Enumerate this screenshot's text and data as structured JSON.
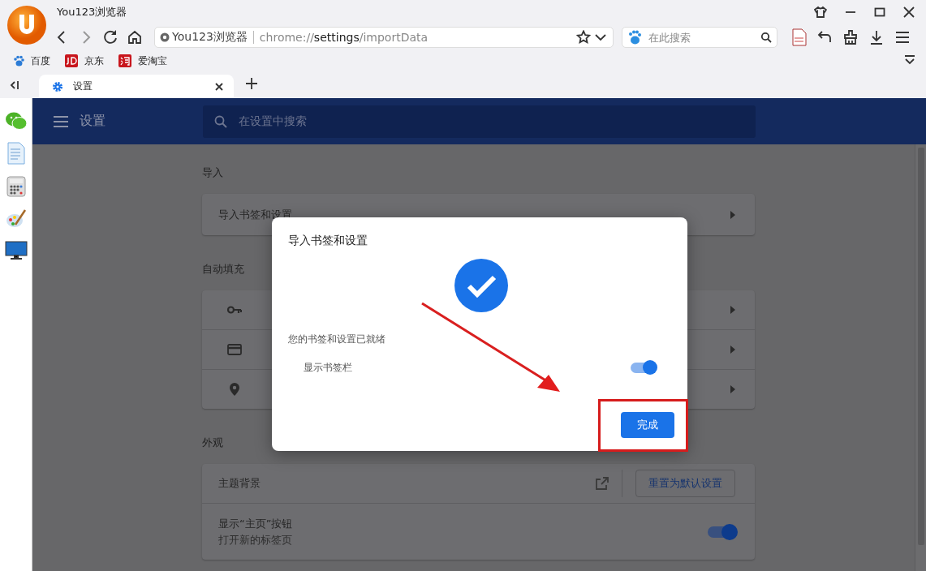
{
  "window": {
    "title": "You123浏览器"
  },
  "address_bar": {
    "site_label": "You123浏览器",
    "url": "chrome://**settings**/importData"
  },
  "search_box": {
    "placeholder": "在此搜索"
  },
  "bookmarks": [
    {
      "label": "百度"
    },
    {
      "label": "京东"
    },
    {
      "label": "爱淘宝"
    }
  ],
  "tabs": [
    {
      "label": "设置",
      "selected": true
    }
  ],
  "settings": {
    "title": "设置",
    "search_placeholder": "在设置中搜索",
    "sections": [
      {
        "heading": "导入",
        "rows": [
          {
            "kind": "link",
            "label": "导入书签和设置"
          }
        ]
      },
      {
        "heading": "自动填充",
        "rows": [
          {
            "kind": "key"
          },
          {
            "kind": "card"
          },
          {
            "kind": "pin"
          }
        ]
      },
      {
        "heading": "外观",
        "rows": [
          {
            "kind": "theme",
            "label": "主题背景",
            "button": "重置为默认设置"
          },
          {
            "kind": "toggle",
            "label": "显示“主页”按钮",
            "sublabel": "打开新的标签页",
            "on": true
          }
        ]
      }
    ]
  },
  "dialog": {
    "title": "导入书签和设置",
    "message": "您的书签和设置已就绪",
    "toggle": {
      "label": "显示书签栏",
      "on": true
    },
    "button": "完成"
  }
}
